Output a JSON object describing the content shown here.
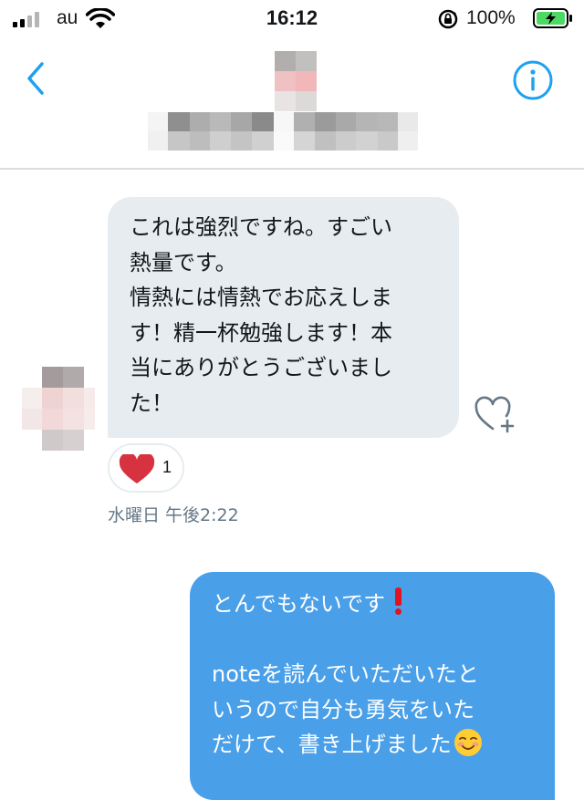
{
  "status_bar": {
    "carrier": "au",
    "time": "16:12",
    "battery_percent": "100%",
    "battery_level": 1.0,
    "signal_bars_filled": 2,
    "signal_bars_total": 4,
    "icons": [
      "signal-icon",
      "wifi-icon",
      "rotation-lock-icon",
      "battery-charging-icon"
    ]
  },
  "header": {
    "icons": [
      "back-chevron-icon",
      "info-icon"
    ],
    "accent_color": "#1da1f2"
  },
  "conversation": {
    "incoming": {
      "lines": [
        "これは強烈ですね。すごい",
        "熱量です。",
        "情熱には情熱でお応えしま",
        "す！精一杯勉強します！本",
        "当にありがとうございまし",
        "た！"
      ],
      "bubble_color": "#e6ecf0"
    },
    "reaction": {
      "icon": "heart-icon",
      "count": "1",
      "color": "#d6323f"
    },
    "timestamp": "水曜日 午後2:22",
    "outgoing": {
      "lines": [
        "とんでもないです",
        "",
        "noteを読んでいただいたと",
        "いうので自分も勇気をいた",
        "だけて、書き上げました"
      ],
      "emoji": [
        "red-exclamation-icon",
        "smiling-face-icon"
      ],
      "bubble_color": "#4a9fe9"
    }
  }
}
